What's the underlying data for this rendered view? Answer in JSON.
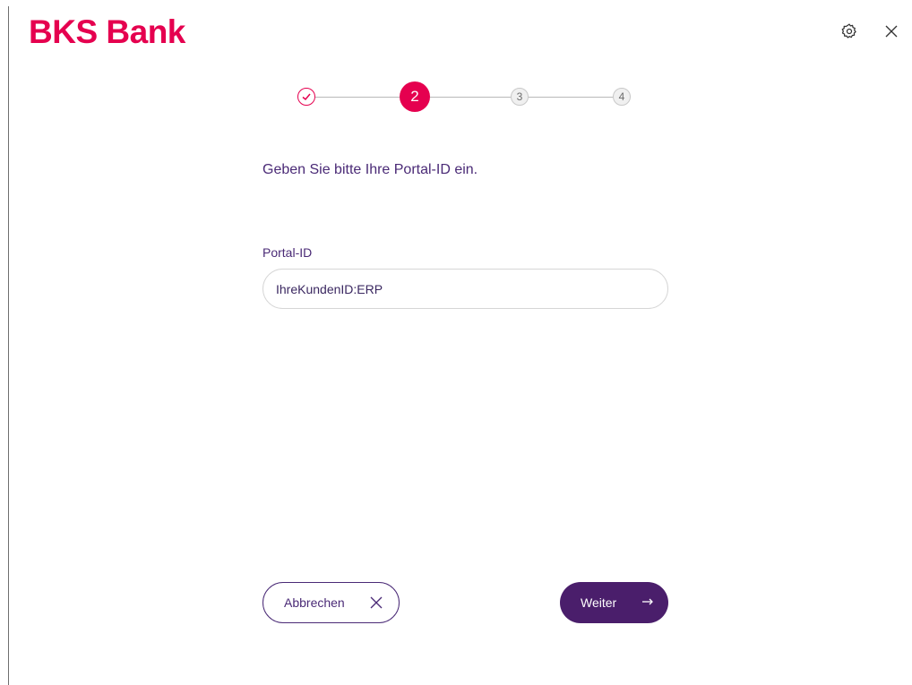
{
  "brand": {
    "name": "BKS Bank",
    "color": "#e5004f"
  },
  "header": {
    "settings_icon": "gear-icon",
    "close_icon": "close-icon"
  },
  "stepper": {
    "steps": [
      {
        "label": "",
        "state": "done",
        "icon": "check-circle-icon"
      },
      {
        "label": "2",
        "state": "active"
      },
      {
        "label": "3",
        "state": "pending"
      },
      {
        "label": "4",
        "state": "pending"
      }
    ]
  },
  "main": {
    "heading": "Geben Sie bitte Ihre Portal-ID ein.",
    "field_label": "Portal-ID",
    "field_value": "IhreKundenID:ERP"
  },
  "buttons": {
    "cancel_label": "Abbrechen",
    "next_label": "Weiter"
  },
  "colors": {
    "accent": "#e5004f",
    "primary": "#4a1e6b",
    "text": "#4a2a76"
  }
}
